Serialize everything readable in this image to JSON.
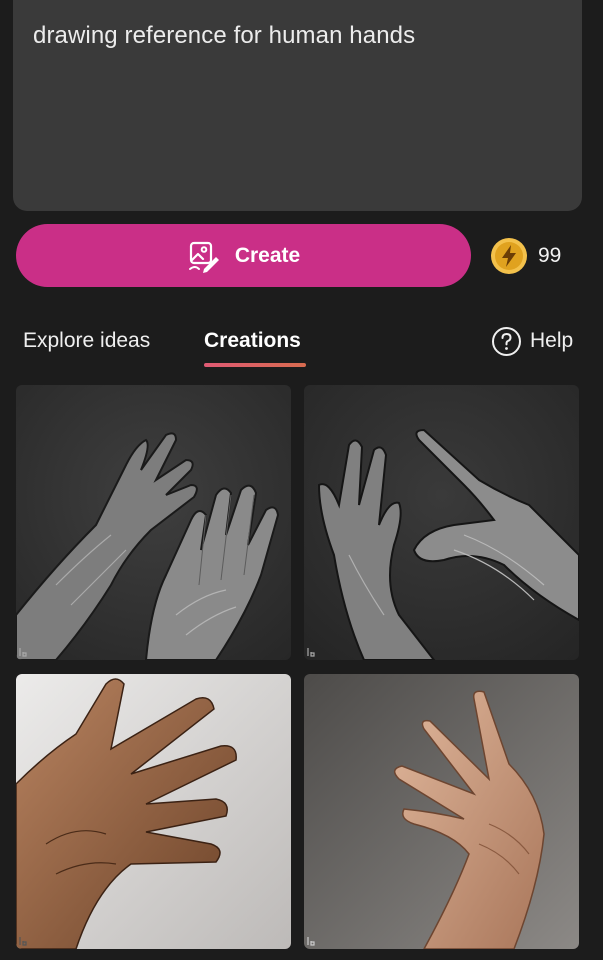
{
  "prompt": {
    "text": "drawing reference for human hands"
  },
  "create_button": {
    "label": "Create",
    "icon": "image-edit-icon",
    "color": "#ca2f87"
  },
  "coins": {
    "icon": "lightning-coin-icon",
    "count": "99",
    "color": "#f0b429"
  },
  "tabs": [
    {
      "label": "Explore ideas",
      "active": false
    },
    {
      "label": "Creations",
      "active": true
    }
  ],
  "help": {
    "icon": "question-circle-icon",
    "label": "Help"
  },
  "creations": [
    {
      "style": "sketch on dark gray",
      "icon": "watermark-icon"
    },
    {
      "style": "sketch on dark gray",
      "icon": "watermark-icon"
    },
    {
      "style": "photo on light background",
      "icon": "watermark-icon"
    },
    {
      "style": "photo on gray background",
      "icon": "watermark-icon"
    }
  ]
}
